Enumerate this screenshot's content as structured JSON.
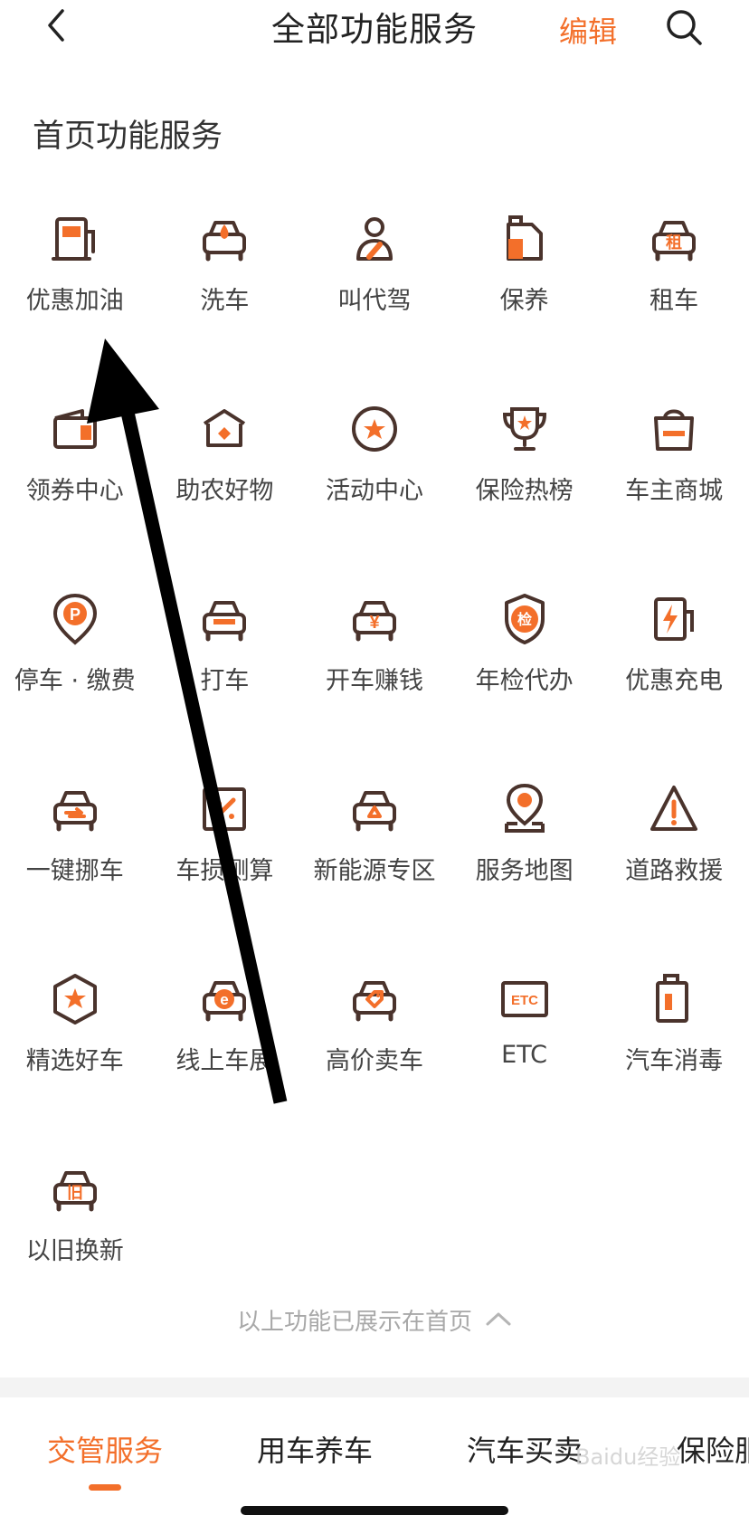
{
  "header": {
    "title": "全部功能服务",
    "edit_label": "编辑",
    "back_icon": "chevron-left-icon",
    "search_icon": "search-icon"
  },
  "section": {
    "title": "首页功能服务"
  },
  "colors": {
    "accent": "#f36f2a",
    "icon_dark": "#4a332c"
  },
  "services": [
    {
      "label": "优惠加油",
      "icon": "fuel-pump-icon"
    },
    {
      "label": "洗车",
      "icon": "car-wash-icon"
    },
    {
      "label": "叫代驾",
      "icon": "chauffeur-icon"
    },
    {
      "label": "保养",
      "icon": "oil-can-icon"
    },
    {
      "label": "租车",
      "icon": "rental-car-icon",
      "glyph": "租"
    },
    {
      "label": "领券中心",
      "icon": "coupon-wallet-icon"
    },
    {
      "label": "助农好物",
      "icon": "farm-goods-icon"
    },
    {
      "label": "活动中心",
      "icon": "star-circle-icon"
    },
    {
      "label": "保险热榜",
      "icon": "trophy-icon"
    },
    {
      "label": "车主商城",
      "icon": "shopping-bag-icon"
    },
    {
      "label": "停车 · 缴费",
      "icon": "parking-pin-icon",
      "glyph": "P"
    },
    {
      "label": "打车",
      "icon": "taxi-icon"
    },
    {
      "label": "开车赚钱",
      "icon": "earn-money-car-icon",
      "glyph": "¥"
    },
    {
      "label": "年检代办",
      "icon": "inspection-shield-icon",
      "glyph": "检"
    },
    {
      "label": "优惠充电",
      "icon": "charging-station-icon"
    },
    {
      "label": "一键挪车",
      "icon": "move-car-icon"
    },
    {
      "label": "车损测算",
      "icon": "damage-estimate-icon"
    },
    {
      "label": "新能源专区",
      "icon": "new-energy-car-icon"
    },
    {
      "label": "服务地图",
      "icon": "map-pin-icon"
    },
    {
      "label": "道路救援",
      "icon": "warning-triangle-icon"
    },
    {
      "label": "精选好车",
      "icon": "star-hexagon-icon"
    },
    {
      "label": "线上车展",
      "icon": "online-auto-show-icon",
      "glyph": "e"
    },
    {
      "label": "高价卖车",
      "icon": "price-tag-car-icon"
    },
    {
      "label": "ETC",
      "icon": "etc-card-icon",
      "glyph": "ETC"
    },
    {
      "label": "汽车消毒",
      "icon": "disinfect-bottle-icon"
    },
    {
      "label": "以旧换新",
      "icon": "trade-in-car-icon",
      "glyph": "旧"
    }
  ],
  "home_note": {
    "text": "以上功能已展示在首页",
    "icon": "chevron-up-icon"
  },
  "tabs": [
    {
      "label": "交管服务",
      "active": true
    },
    {
      "label": "用车养车",
      "active": false
    },
    {
      "label": "汽车买卖",
      "active": false
    },
    {
      "label": "保险服",
      "active": false
    }
  ],
  "watermark": "Baidu经验"
}
